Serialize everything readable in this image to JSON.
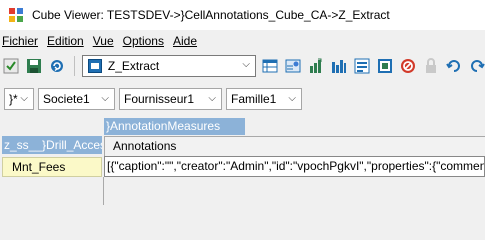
{
  "window": {
    "title": "Cube Viewer: TESTSDEV->}CellAnnotations_Cube_CA->Z_Extract"
  },
  "menu": [
    {
      "label": "Fichier"
    },
    {
      "label": "Edition"
    },
    {
      "label": "Vue"
    },
    {
      "label": "Options"
    },
    {
      "label": "Aide"
    }
  ],
  "toolbar": {
    "view_name": "Z_Extract",
    "icons": [
      "check-icon",
      "save-icon",
      "refresh-icon",
      "view-icon",
      "grid-settings-icon",
      "export-icon",
      "chart-icon",
      "sheet-icon",
      "report-icon",
      "stop-icon",
      "sandbox-icon",
      "undo-icon",
      "redo-icon"
    ]
  },
  "dimensions": [
    {
      "value": "}*"
    },
    {
      "value": "Societe1"
    },
    {
      "value": "Fournisseur1"
    },
    {
      "value": "Famille1"
    }
  ],
  "grid": {
    "column_dimension": "}AnnotationMeasures",
    "row_dimension": "z_ss__}Drill_Acces",
    "column_header": "Annotations",
    "row_header": "Mnt_Fees",
    "cell_value": "[{\"caption\":\"\",\"creator\":\"Admin\",\"id\":\"vpochPgkvI\",\"properties\":{\"commentLoca"
  },
  "colors": {
    "chip": "#8cb2d8",
    "row_label_bg": "#fbf9c8",
    "window_bg": "#f0f0f0"
  }
}
